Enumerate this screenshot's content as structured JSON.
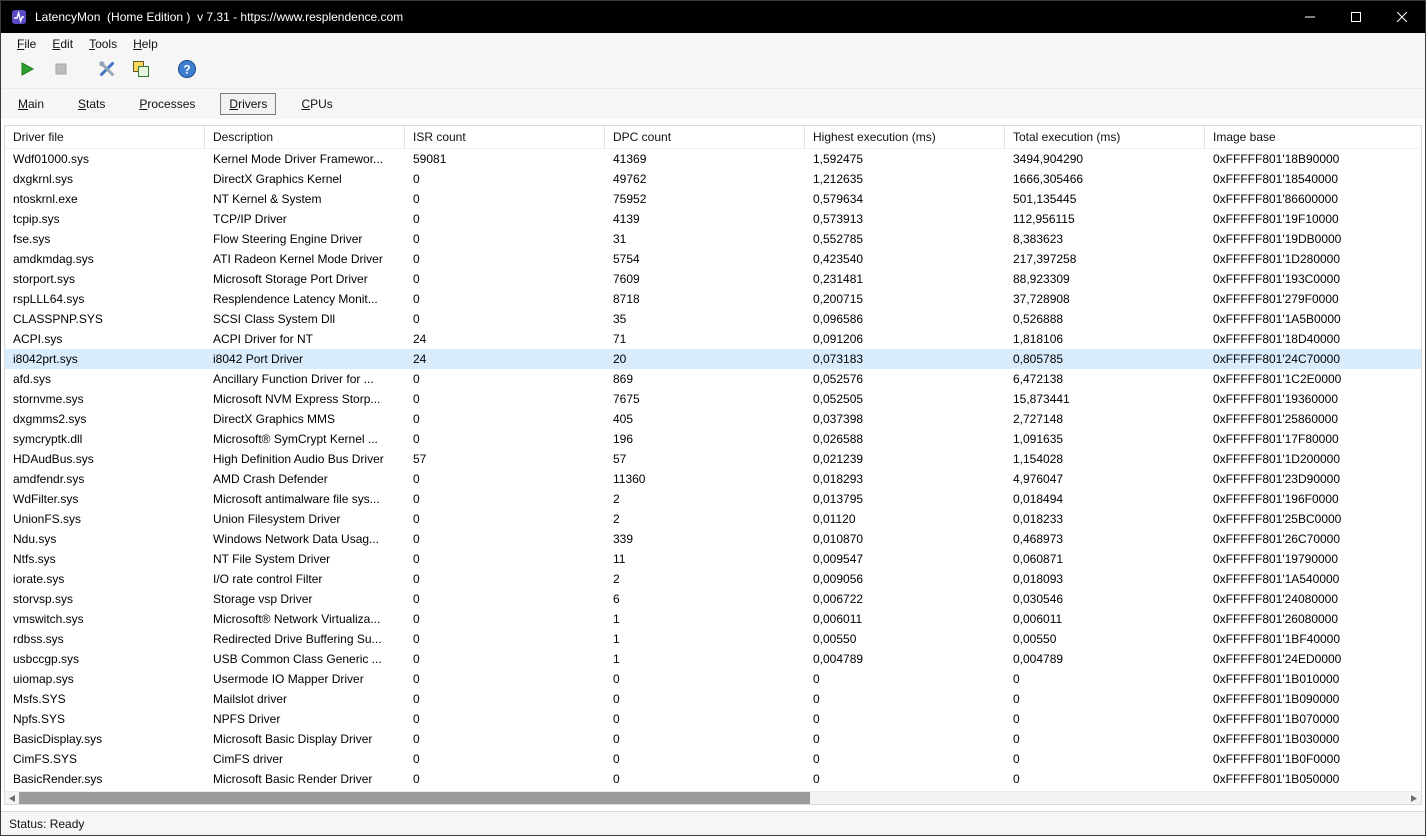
{
  "window": {
    "title": "LatencyMon  (Home Edition )  v 7.31 - https://www.resplendence.com",
    "controls": [
      "minimize",
      "maximize",
      "close"
    ]
  },
  "menu": {
    "items": [
      "File",
      "Edit",
      "Tools",
      "Help"
    ]
  },
  "toolbar": {
    "buttons": [
      {
        "name": "start-monitor",
        "icon": "play-icon",
        "enabled": true,
        "gap_after": false
      },
      {
        "name": "stop-monitor",
        "icon": "stop-icon",
        "enabled": false,
        "gap_after": true
      },
      {
        "name": "options",
        "icon": "tools-icon",
        "enabled": true,
        "gap_after": false
      },
      {
        "name": "copy-report",
        "icon": "copy-icon",
        "enabled": true,
        "gap_after": true
      },
      {
        "name": "help",
        "icon": "help-icon",
        "enabled": true,
        "gap_after": false
      }
    ]
  },
  "tabs": [
    {
      "label": "Main",
      "active": false
    },
    {
      "label": "Stats",
      "active": false
    },
    {
      "label": "Processes",
      "active": false
    },
    {
      "label": "Drivers",
      "active": true
    },
    {
      "label": "CPUs",
      "active": false
    }
  ],
  "table": {
    "columns": [
      "Driver file",
      "Description",
      "ISR count",
      "DPC count",
      "Highest execution (ms)",
      "Total execution (ms)",
      "Image base"
    ],
    "selected_row_index": 10,
    "rows": [
      [
        "Wdf01000.sys",
        "Kernel Mode Driver Framewor...",
        "59081",
        "41369",
        "1,592475",
        "3494,904290",
        "0xFFFFF801'18B90000"
      ],
      [
        "dxgkrnl.sys",
        "DirectX Graphics Kernel",
        "0",
        "49762",
        "1,212635",
        "1666,305466",
        "0xFFFFF801'18540000"
      ],
      [
        "ntoskrnl.exe",
        "NT Kernel & System",
        "0",
        "75952",
        "0,579634",
        "501,135445",
        "0xFFFFF801'86600000"
      ],
      [
        "tcpip.sys",
        "TCP/IP Driver",
        "0",
        "4139",
        "0,573913",
        "112,956115",
        "0xFFFFF801'19F10000"
      ],
      [
        "fse.sys",
        "Flow Steering Engine Driver",
        "0",
        "31",
        "0,552785",
        "8,383623",
        "0xFFFFF801'19DB0000"
      ],
      [
        "amdkmdag.sys",
        "ATI Radeon Kernel Mode Driver",
        "0",
        "5754",
        "0,423540",
        "217,397258",
        "0xFFFFF801'1D280000"
      ],
      [
        "storport.sys",
        "Microsoft Storage Port Driver",
        "0",
        "7609",
        "0,231481",
        "88,923309",
        "0xFFFFF801'193C0000"
      ],
      [
        "rspLLL64.sys",
        "Resplendence Latency Monit...",
        "0",
        "8718",
        "0,200715",
        "37,728908",
        "0xFFFFF801'279F0000"
      ],
      [
        "CLASSPNP.SYS",
        "SCSI Class System Dll",
        "0",
        "35",
        "0,096586",
        "0,526888",
        "0xFFFFF801'1A5B0000"
      ],
      [
        "ACPI.sys",
        "ACPI Driver for NT",
        "24",
        "71",
        "0,091206",
        "1,818106",
        "0xFFFFF801'18D40000"
      ],
      [
        "i8042prt.sys",
        "i8042 Port Driver",
        "24",
        "20",
        "0,073183",
        "0,805785",
        "0xFFFFF801'24C70000"
      ],
      [
        "afd.sys",
        "Ancillary Function Driver for ...",
        "0",
        "869",
        "0,052576",
        "6,472138",
        "0xFFFFF801'1C2E0000"
      ],
      [
        "stornvme.sys",
        "Microsoft NVM Express Storp...",
        "0",
        "7675",
        "0,052505",
        "15,873441",
        "0xFFFFF801'19360000"
      ],
      [
        "dxgmms2.sys",
        "DirectX Graphics MMS",
        "0",
        "405",
        "0,037398",
        "2,727148",
        "0xFFFFF801'25860000"
      ],
      [
        "symcryptk.dll",
        "Microsoft® SymCrypt Kernel ...",
        "0",
        "196",
        "0,026588",
        "1,091635",
        "0xFFFFF801'17F80000"
      ],
      [
        "HDAudBus.sys",
        "High Definition Audio Bus Driver",
        "57",
        "57",
        "0,021239",
        "1,154028",
        "0xFFFFF801'1D200000"
      ],
      [
        "amdfendr.sys",
        "AMD Crash Defender",
        "0",
        "11360",
        "0,018293",
        "4,976047",
        "0xFFFFF801'23D90000"
      ],
      [
        "WdFilter.sys",
        "Microsoft antimalware file sys...",
        "0",
        "2",
        "0,013795",
        "0,018494",
        "0xFFFFF801'196F0000"
      ],
      [
        "UnionFS.sys",
        "Union Filesystem Driver",
        "0",
        "2",
        "0,01120",
        "0,018233",
        "0xFFFFF801'25BC0000"
      ],
      [
        "Ndu.sys",
        "Windows Network Data Usag...",
        "0",
        "339",
        "0,010870",
        "0,468973",
        "0xFFFFF801'26C70000"
      ],
      [
        "Ntfs.sys",
        "NT File System Driver",
        "0",
        "11",
        "0,009547",
        "0,060871",
        "0xFFFFF801'19790000"
      ],
      [
        "iorate.sys",
        "I/O rate control Filter",
        "0",
        "2",
        "0,009056",
        "0,018093",
        "0xFFFFF801'1A540000"
      ],
      [
        "storvsp.sys",
        "Storage vsp Driver",
        "0",
        "6",
        "0,006722",
        "0,030546",
        "0xFFFFF801'24080000"
      ],
      [
        "vmswitch.sys",
        "Microsoft® Network Virtualiza...",
        "0",
        "1",
        "0,006011",
        "0,006011",
        "0xFFFFF801'26080000"
      ],
      [
        "rdbss.sys",
        "Redirected Drive Buffering Su...",
        "0",
        "1",
        "0,00550",
        "0,00550",
        "0xFFFFF801'1BF40000"
      ],
      [
        "usbccgp.sys",
        "USB Common Class Generic ...",
        "0",
        "1",
        "0,004789",
        "0,004789",
        "0xFFFFF801'24ED0000"
      ],
      [
        "uiomap.sys",
        "Usermode IO Mapper Driver",
        "0",
        "0",
        "0",
        "0",
        "0xFFFFF801'1B010000"
      ],
      [
        "Msfs.SYS",
        "Mailslot driver",
        "0",
        "0",
        "0",
        "0",
        "0xFFFFF801'1B090000"
      ],
      [
        "Npfs.SYS",
        "NPFS Driver",
        "0",
        "0",
        "0",
        "0",
        "0xFFFFF801'1B070000"
      ],
      [
        "BasicDisplay.sys",
        "Microsoft Basic Display Driver",
        "0",
        "0",
        "0",
        "0",
        "0xFFFFF801'1B030000"
      ],
      [
        "CimFS.SYS",
        "CimFS driver",
        "0",
        "0",
        "0",
        "0",
        "0xFFFFF801'1B0F0000"
      ],
      [
        "BasicRender.sys",
        "Microsoft Basic Render Driver",
        "0",
        "0",
        "0",
        "0",
        "0xFFFFF801'1B050000"
      ]
    ]
  },
  "scrollbar": {
    "thumb_left_pct": 0,
    "thumb_width_pct": 57
  },
  "status_bar": {
    "text": "Status: Ready"
  },
  "colors": {
    "titlebar": "#000000",
    "chrome": "#f6f6f6",
    "selection": "#d9ecfb",
    "scroll_thumb": "#9b9b9b"
  }
}
